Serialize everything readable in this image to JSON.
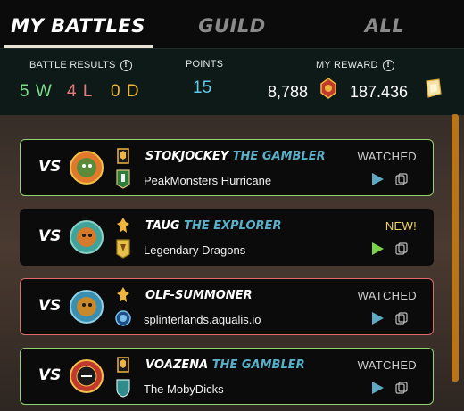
{
  "tabs": [
    {
      "label": "MY BATTLES",
      "active": true
    },
    {
      "label": "GUILD",
      "active": false
    },
    {
      "label": "ALL",
      "active": false
    }
  ],
  "summary": {
    "battle_results_label": "BATTLE RESULTS",
    "wins": "5 W",
    "losses": "4 L",
    "draws": "0 D",
    "points_label": "POINTS",
    "points": "15",
    "reward_label": "MY REWARD",
    "reward_merits": "8,788",
    "reward_sps": "187.436"
  },
  "battles": [
    {
      "vs": "VS",
      "player": "STOKJOCKEY",
      "title": "THE GAMBLER",
      "guild": "PeakMonsters Hurricane",
      "status": "WATCHED",
      "border": "green",
      "is_new": false
    },
    {
      "vs": "VS",
      "player": "TAUG",
      "title": "THE EXPLORER",
      "guild": "Legendary Dragons",
      "status": "NEW!",
      "border": "none",
      "is_new": true
    },
    {
      "vs": "VS",
      "player": "OLF-SUMMONER",
      "title": "",
      "guild": "splinterlands.aqualis.io",
      "status": "WATCHED",
      "border": "red",
      "is_new": false
    },
    {
      "vs": "VS",
      "player": "VOAZENA",
      "title": "THE GAMBLER",
      "guild": "The MobyDicks",
      "status": "WATCHED",
      "border": "green",
      "is_new": false
    }
  ],
  "colors": {
    "win": "#7ddc8a",
    "loss": "#e87a7a",
    "draw": "#f0b53c",
    "points": "#5fc9e8",
    "player_title": "#5ab0c8",
    "new_status": "#f0d25a",
    "scrollbar": "#b8741a"
  }
}
